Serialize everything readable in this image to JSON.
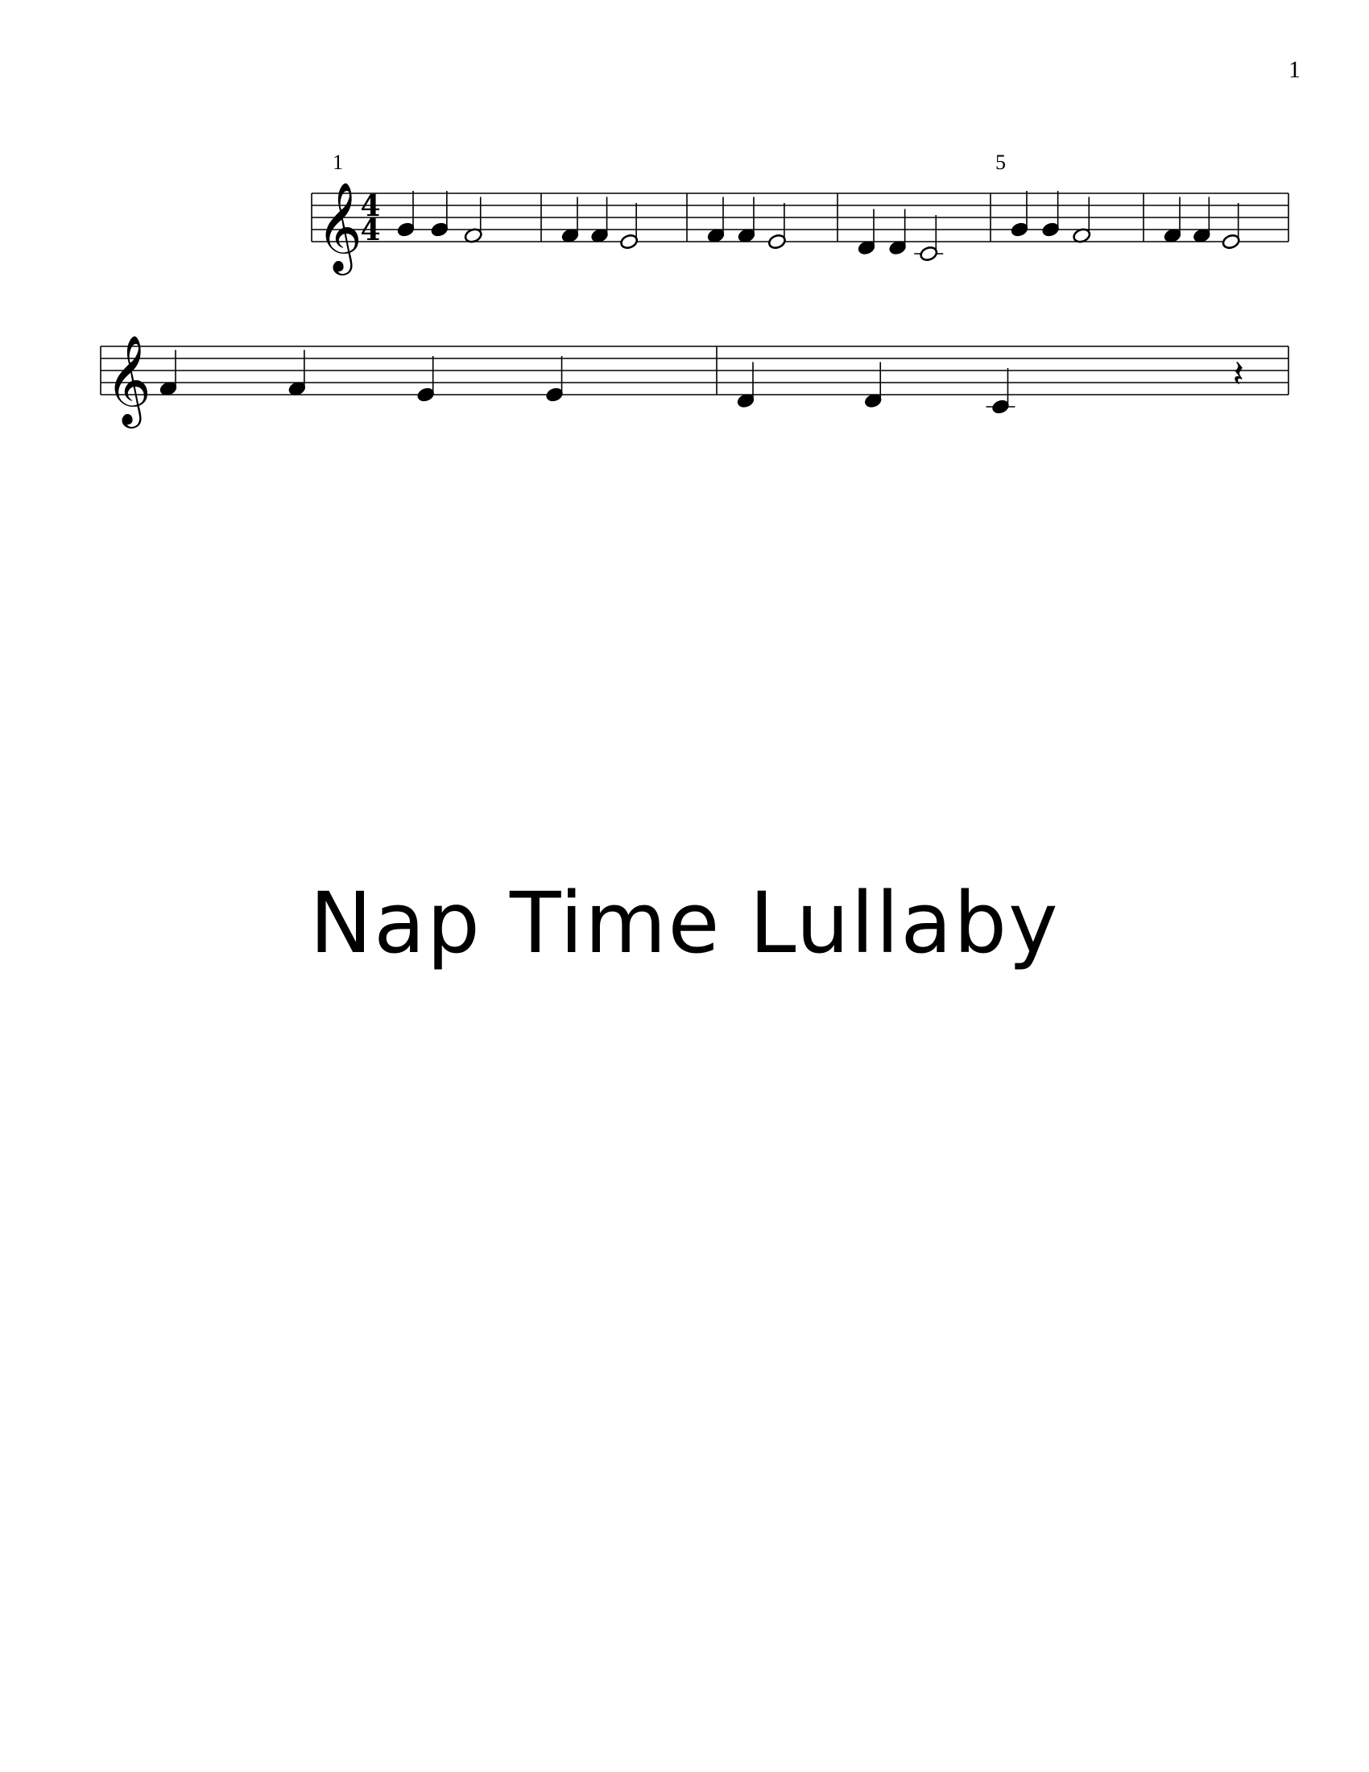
{
  "page": {
    "number": "1"
  },
  "score": {
    "time_signature": {
      "numerator": "4",
      "denominator": "4"
    },
    "clef": "treble",
    "systems": [
      {
        "measure_number": "1",
        "measures": [
          [
            {
              "pitch": "G4",
              "duration": "quarter"
            },
            {
              "pitch": "G4",
              "duration": "quarter"
            },
            {
              "pitch": "F4",
              "duration": "half"
            }
          ],
          [
            {
              "pitch": "F4",
              "duration": "quarter"
            },
            {
              "pitch": "F4",
              "duration": "quarter"
            },
            {
              "pitch": "E4",
              "duration": "half"
            }
          ],
          [
            {
              "pitch": "F4",
              "duration": "quarter"
            },
            {
              "pitch": "F4",
              "duration": "quarter"
            },
            {
              "pitch": "E4",
              "duration": "half"
            }
          ],
          [
            {
              "pitch": "D4",
              "duration": "quarter"
            },
            {
              "pitch": "D4",
              "duration": "quarter"
            },
            {
              "pitch": "C4",
              "duration": "half"
            }
          ],
          [
            {
              "pitch": "G4",
              "duration": "quarter"
            },
            {
              "pitch": "G4",
              "duration": "quarter"
            },
            {
              "pitch": "F4",
              "duration": "half"
            }
          ],
          [
            {
              "pitch": "F4",
              "duration": "quarter"
            },
            {
              "pitch": "F4",
              "duration": "quarter"
            },
            {
              "pitch": "E4",
              "duration": "half"
            }
          ]
        ],
        "numbered_measures": [
          {
            "index": 0,
            "label": "1"
          },
          {
            "index": 4,
            "label": "5"
          }
        ]
      },
      {
        "measure_number": "",
        "measures": [
          [
            {
              "pitch": "F4",
              "duration": "quarter"
            },
            {
              "pitch": "F4",
              "duration": "quarter"
            },
            {
              "pitch": "E4",
              "duration": "quarter"
            },
            {
              "pitch": "E4",
              "duration": "quarter"
            }
          ],
          [
            {
              "pitch": "D4",
              "duration": "quarter"
            },
            {
              "pitch": "D4",
              "duration": "quarter"
            },
            {
              "pitch": "C4",
              "duration": "quarter"
            },
            {
              "pitch": "rest",
              "duration": "quarter"
            }
          ]
        ],
        "numbered_measures": []
      }
    ]
  },
  "title": "Nap Time Lullaby"
}
